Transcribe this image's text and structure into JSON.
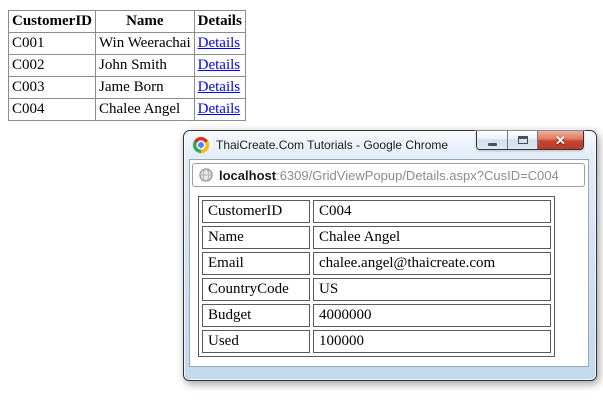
{
  "colors": {
    "link_blue": "#0000ee",
    "close_button_red": "#c94330",
    "window_frame_blue": "#cfe1f3",
    "table_border_grey": "#8c8c8c"
  },
  "gridview": {
    "headers": {
      "customer_id": "CustomerID",
      "name": "Name",
      "details": "Details"
    },
    "rows": [
      {
        "id": "C001",
        "name": "Win Weerachai",
        "details_label": "Details"
      },
      {
        "id": "C002",
        "name": "John Smith",
        "details_label": "Details"
      },
      {
        "id": "C003",
        "name": "Jame Born",
        "details_label": "Details"
      },
      {
        "id": "C004",
        "name": "Chalee Angel",
        "details_label": "Details"
      }
    ]
  },
  "popup": {
    "titlebar": {
      "title": "ThaiCreate.Com Tutorials - Google Chrome",
      "app_icon": "chrome-logo",
      "buttons": [
        "minimize",
        "maximize",
        "close"
      ]
    },
    "address_bar": {
      "icon": "globe-page-icon",
      "host": "localhost",
      "path": ":6309/GridViewPopup/Details.aspx?CusID=C004"
    },
    "details_table": {
      "rows": [
        {
          "label": "CustomerID",
          "value": "C004"
        },
        {
          "label": "Name",
          "value": "Chalee Angel"
        },
        {
          "label": "Email",
          "value": "chalee.angel@thaicreate.com"
        },
        {
          "label": "CountryCode",
          "value": "US"
        },
        {
          "label": "Budget",
          "value": "4000000"
        },
        {
          "label": "Used",
          "value": "100000"
        }
      ]
    }
  }
}
